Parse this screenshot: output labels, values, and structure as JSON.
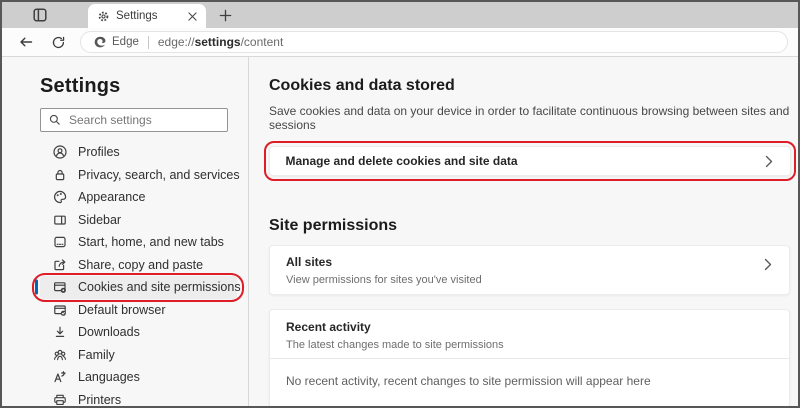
{
  "tab_bar": {
    "tab_title": "Settings"
  },
  "address_bar": {
    "badge_label": "Edge",
    "url_prefix": "edge://",
    "url_bold": "settings",
    "url_suffix": "/content"
  },
  "sidebar": {
    "title": "Settings",
    "search_placeholder": "Search settings",
    "items": [
      {
        "label": "Profiles",
        "selected": false
      },
      {
        "label": "Privacy, search, and services",
        "selected": false
      },
      {
        "label": "Appearance",
        "selected": false
      },
      {
        "label": "Sidebar",
        "selected": false
      },
      {
        "label": "Start, home, and new tabs",
        "selected": false
      },
      {
        "label": "Share, copy and paste",
        "selected": false
      },
      {
        "label": "Cookies and site permissions",
        "selected": true
      },
      {
        "label": "Default browser",
        "selected": false
      },
      {
        "label": "Downloads",
        "selected": false
      },
      {
        "label": "Family",
        "selected": false
      },
      {
        "label": "Languages",
        "selected": false
      },
      {
        "label": "Printers",
        "selected": false
      }
    ]
  },
  "main": {
    "cookies_section": {
      "title": "Cookies and data stored",
      "description": "Save cookies and data on your device in order to facilitate continuous browsing between sites and sessions",
      "manage_card_title": "Manage and delete cookies and site data"
    },
    "permissions_section": {
      "title": "Site permissions",
      "all_sites": {
        "title": "All sites",
        "subtitle": "View permissions for sites you've visited"
      },
      "recent_activity": {
        "title": "Recent activity",
        "subtitle": "The latest changes made to site permissions",
        "empty_text": "No recent activity, recent changes to site permission will appear here"
      }
    }
  },
  "colors": {
    "accent_blue": "#0067b8",
    "annotation_red": "#dd1d28",
    "tabbar_gray": "#cecece",
    "page_background": "#f7f7f7"
  }
}
